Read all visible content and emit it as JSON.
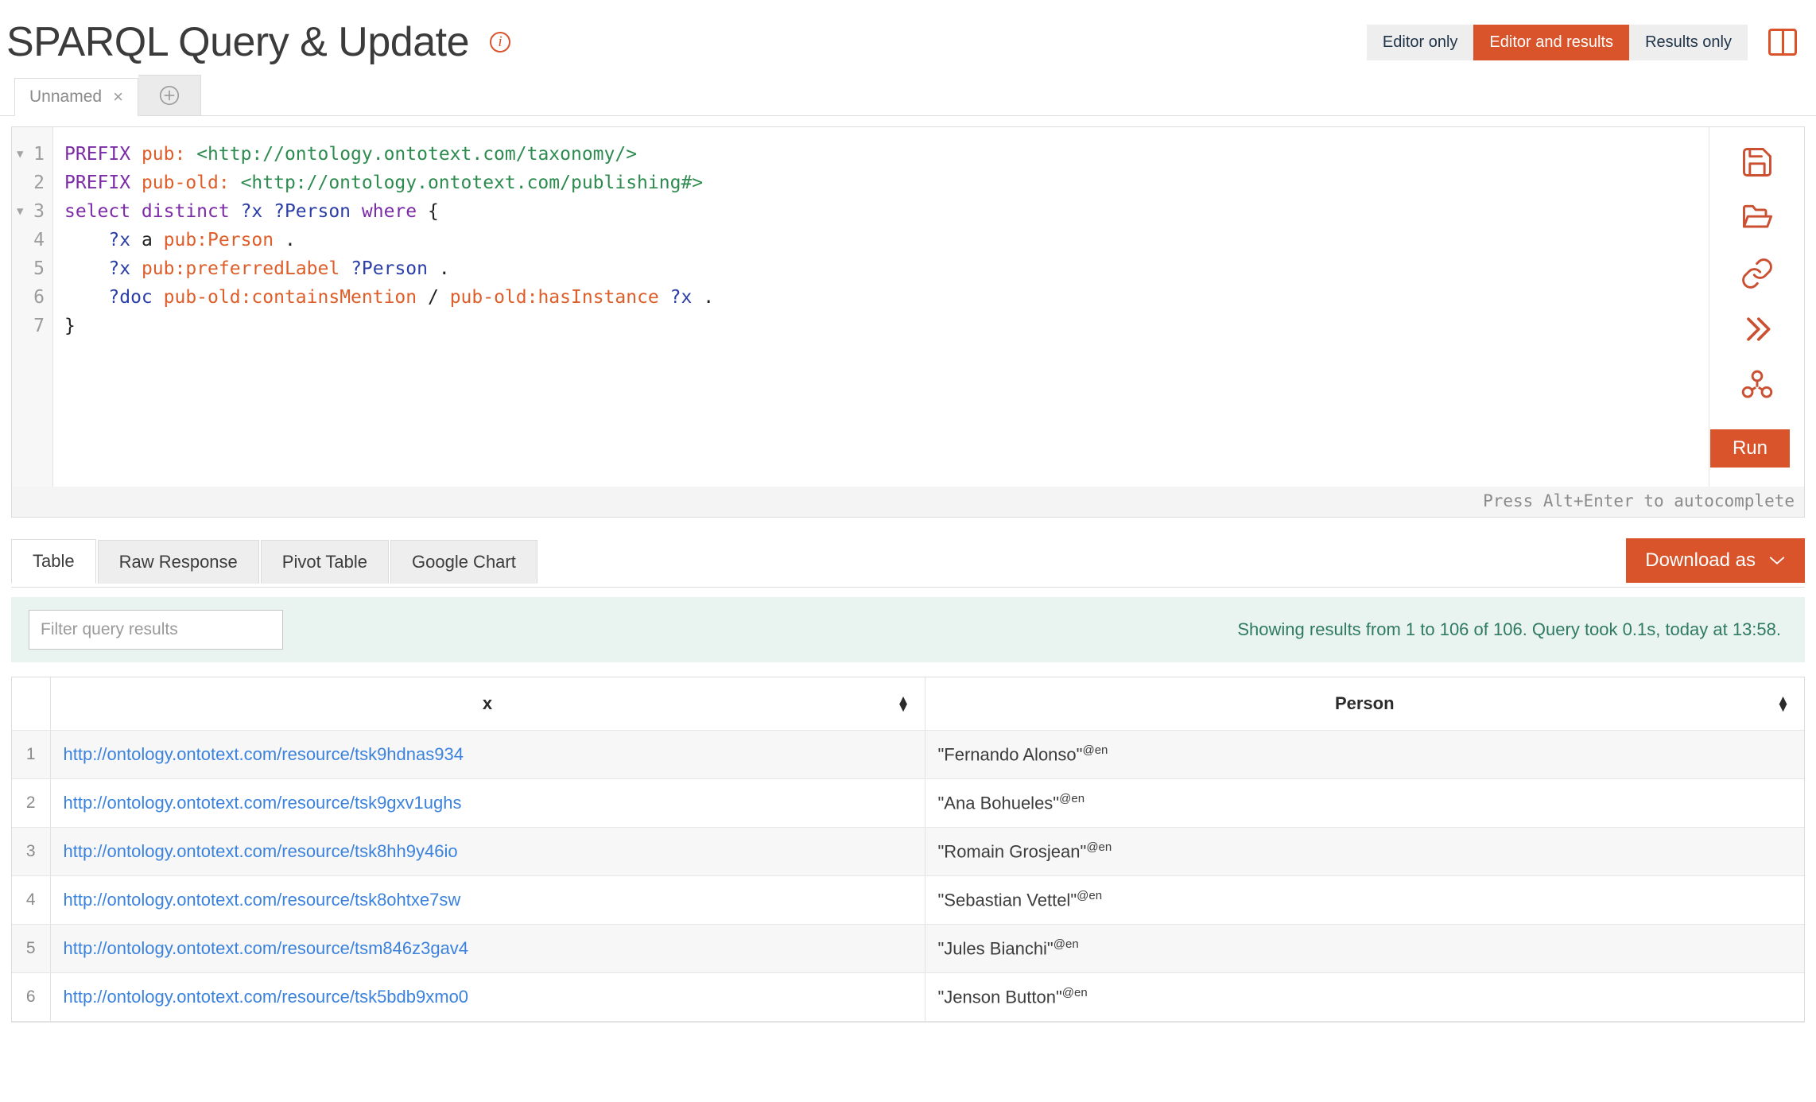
{
  "header": {
    "title": "SPARQL Query & Update",
    "info_icon": "info-icon",
    "view_modes": [
      {
        "label": "Editor only",
        "active": false
      },
      {
        "label": "Editor and results",
        "active": true
      },
      {
        "label": "Results only",
        "active": false
      }
    ],
    "split_view_icon": "split-view-icon",
    "accent_color": "#d9542b"
  },
  "query_tabs": {
    "tabs": [
      {
        "label": "Unnamed",
        "close": "×"
      }
    ],
    "add_label": "add-tab"
  },
  "editor": {
    "line_numbers": [
      "1",
      "2",
      "3",
      "4",
      "5",
      "6",
      "7"
    ],
    "folds": [
      true,
      false,
      true,
      false,
      false,
      false,
      false
    ],
    "lines": [
      [
        {
          "t": "PREFIX ",
          "c": "kw"
        },
        {
          "t": "pub: ",
          "c": "pfx"
        },
        {
          "t": "<http://ontology.ontotext.com/taxonomy/>",
          "c": "uri"
        }
      ],
      [
        {
          "t": "PREFIX ",
          "c": "kw"
        },
        {
          "t": "pub-old: ",
          "c": "pfx"
        },
        {
          "t": "<http://ontology.ontotext.com/publishing#>",
          "c": "uri"
        }
      ],
      [
        {
          "t": "select distinct ",
          "c": "kw"
        },
        {
          "t": "?x ?Person ",
          "c": "var"
        },
        {
          "t": "where ",
          "c": "kw"
        },
        {
          "t": "{",
          "c": "op"
        }
      ],
      [
        {
          "t": "    ",
          "c": "op"
        },
        {
          "t": "?x",
          "c": "var"
        },
        {
          "t": " a ",
          "c": "op"
        },
        {
          "t": "pub:Person",
          "c": "pn"
        },
        {
          "t": " .",
          "c": "op"
        }
      ],
      [
        {
          "t": "    ",
          "c": "op"
        },
        {
          "t": "?x",
          "c": "var"
        },
        {
          "t": " ",
          "c": "op"
        },
        {
          "t": "pub:preferredLabel",
          "c": "pn"
        },
        {
          "t": " ",
          "c": "op"
        },
        {
          "t": "?Person",
          "c": "var"
        },
        {
          "t": " .",
          "c": "op"
        }
      ],
      [
        {
          "t": "    ",
          "c": "op"
        },
        {
          "t": "?doc",
          "c": "var"
        },
        {
          "t": " ",
          "c": "op"
        },
        {
          "t": "pub-old:containsMention",
          "c": "pn"
        },
        {
          "t": " / ",
          "c": "op"
        },
        {
          "t": "pub-old:hasInstance",
          "c": "pn"
        },
        {
          "t": " ",
          "c": "op"
        },
        {
          "t": "?x",
          "c": "var"
        },
        {
          "t": " .",
          "c": "op"
        }
      ],
      [
        {
          "t": "}",
          "c": "op"
        }
      ]
    ],
    "actions": [
      {
        "name": "save-query-icon"
      },
      {
        "name": "open-query-icon"
      },
      {
        "name": "copy-link-icon"
      },
      {
        "name": "expand-results-icon"
      },
      {
        "name": "visual-graph-icon"
      }
    ],
    "run_label": "Run",
    "hint": "Press Alt+Enter to autocomplete"
  },
  "results": {
    "tabs": [
      {
        "label": "Table",
        "active": true
      },
      {
        "label": "Raw Response",
        "active": false
      },
      {
        "label": "Pivot Table",
        "active": false
      },
      {
        "label": "Google Chart",
        "active": false
      }
    ],
    "download_label": "Download as",
    "download_caret": "chevron-down-icon",
    "filter_placeholder": "Filter query results",
    "filter_value": "",
    "info": "Showing results from 1 to 106 of 106. Query took 0.1s, today at 13:58.",
    "columns": [
      {
        "label": "x",
        "sortable": true
      },
      {
        "label": "Person",
        "sortable": true
      }
    ],
    "rows": [
      {
        "n": "1",
        "x": "http://ontology.ontotext.com/resource/tsk9hdnas934",
        "person": "\"Fernando Alonso\"",
        "lang": "@en"
      },
      {
        "n": "2",
        "x": "http://ontology.ontotext.com/resource/tsk9gxv1ughs",
        "person": "\"Ana Bohueles\"",
        "lang": "@en"
      },
      {
        "n": "3",
        "x": "http://ontology.ontotext.com/resource/tsk8hh9y46io",
        "person": "\"Romain Grosjean\"",
        "lang": "@en"
      },
      {
        "n": "4",
        "x": "http://ontology.ontotext.com/resource/tsk8ohtxe7sw",
        "person": "\"Sebastian Vettel\"",
        "lang": "@en"
      },
      {
        "n": "5",
        "x": "http://ontology.ontotext.com/resource/tsm846z3gav4",
        "person": "\"Jules Bianchi\"",
        "lang": "@en"
      },
      {
        "n": "6",
        "x": "http://ontology.ontotext.com/resource/tsk5bdb9xmo0",
        "person": "\"Jenson Button\"",
        "lang": "@en"
      }
    ]
  }
}
